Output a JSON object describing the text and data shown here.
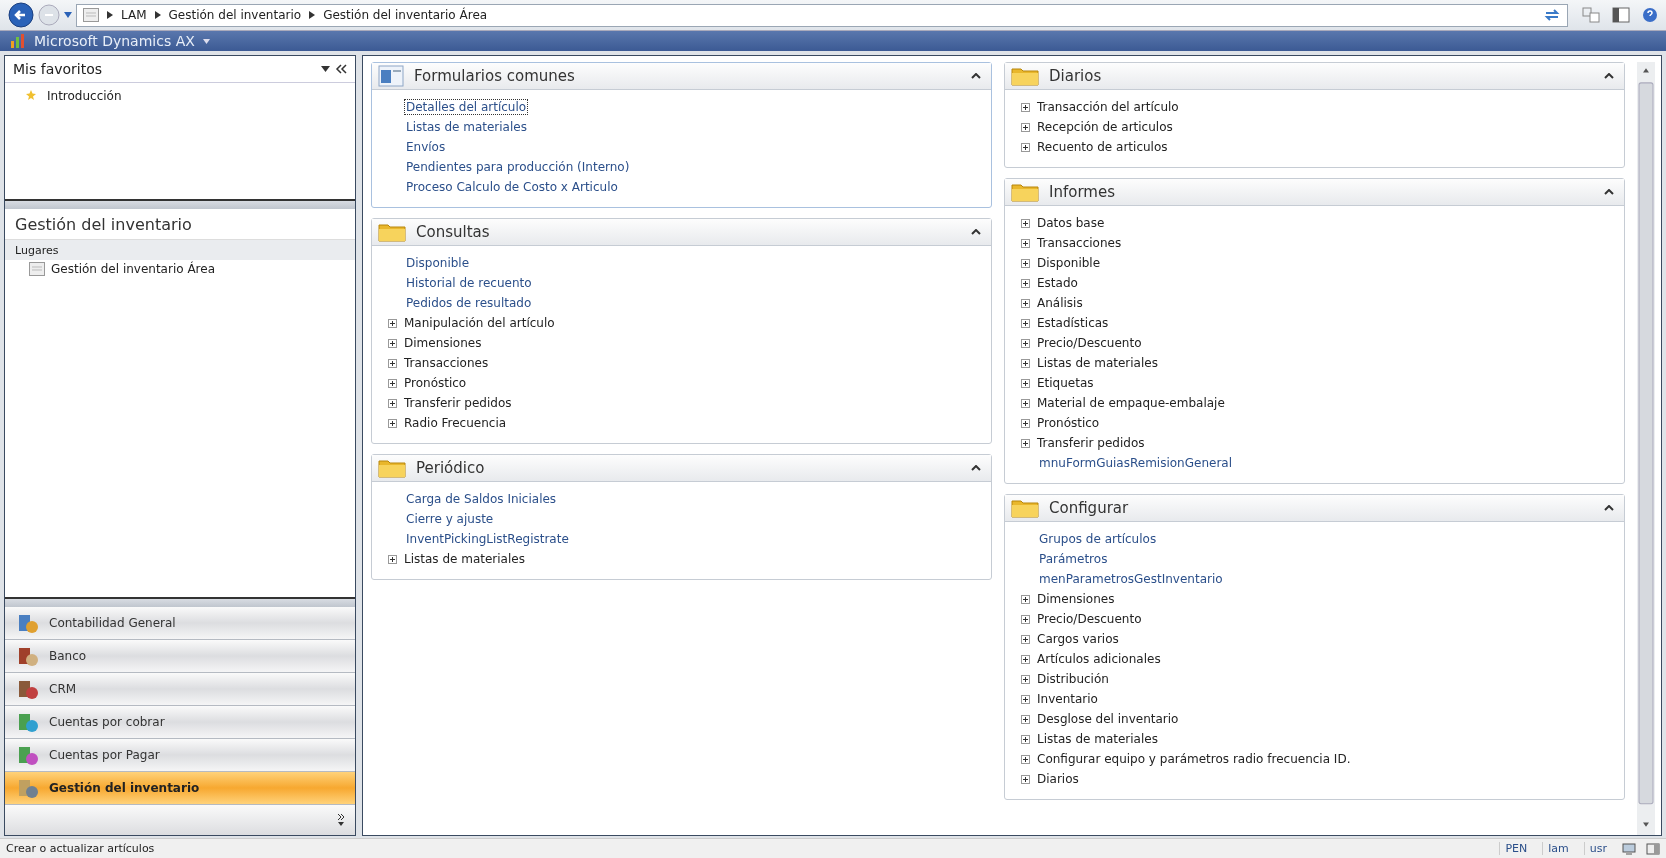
{
  "address_bar": {
    "breadcrumbs": [
      "LAM",
      "Gestión del inventario",
      "Gestión del inventario Área"
    ]
  },
  "app_bar": {
    "title": "Microsoft Dynamics AX"
  },
  "favorites": {
    "title": "Mis favoritos",
    "items": [
      "Introducción"
    ]
  },
  "area": {
    "title": "Gestión del inventario",
    "group": "Lugares",
    "items": [
      "Gestión del inventario Área"
    ]
  },
  "modules": [
    {
      "label": "Contabilidad General",
      "selected": false
    },
    {
      "label": "Banco",
      "selected": false
    },
    {
      "label": "CRM",
      "selected": false
    },
    {
      "label": "Cuentas por cobrar",
      "selected": false
    },
    {
      "label": "Cuentas por Pagar",
      "selected": false
    },
    {
      "label": "Gestión del inventario",
      "selected": true
    }
  ],
  "left_sections": [
    {
      "title": "Formularios comunes",
      "items": [
        {
          "label": "Detalles del artículo",
          "kind": "link",
          "focused": true
        },
        {
          "label": "Listas de materiales",
          "kind": "link",
          "focused": false
        },
        {
          "label": "Envíos",
          "kind": "link",
          "focused": false
        },
        {
          "label": "Pendientes para producción (Interno)",
          "kind": "link",
          "focused": false
        },
        {
          "label": "Proceso Calculo de Costo x Articulo",
          "kind": "link",
          "focused": false
        }
      ]
    },
    {
      "title": "Consultas",
      "items": [
        {
          "label": "Disponible",
          "kind": "link"
        },
        {
          "label": "Historial de recuento",
          "kind": "link"
        },
        {
          "label": "Pedidos de resultado",
          "kind": "link"
        },
        {
          "label": "Manipulación del artículo",
          "kind": "group"
        },
        {
          "label": "Dimensiones",
          "kind": "group"
        },
        {
          "label": "Transacciones",
          "kind": "group"
        },
        {
          "label": "Pronóstico",
          "kind": "group"
        },
        {
          "label": "Transferir pedidos",
          "kind": "group"
        },
        {
          "label": "Radio Frecuencia",
          "kind": "group"
        }
      ]
    },
    {
      "title": "Periódico",
      "items": [
        {
          "label": "Carga de Saldos Iniciales",
          "kind": "link"
        },
        {
          "label": "Cierre y ajuste",
          "kind": "link"
        },
        {
          "label": "InventPickingListRegistrate",
          "kind": "link"
        },
        {
          "label": "Listas de materiales",
          "kind": "group"
        }
      ]
    }
  ],
  "right_sections": [
    {
      "title": "Diarios",
      "items": [
        {
          "label": "Transacción del artículo",
          "kind": "group"
        },
        {
          "label": "Recepción de articulos",
          "kind": "group"
        },
        {
          "label": "Recuento de articulos",
          "kind": "group"
        }
      ]
    },
    {
      "title": "Informes",
      "items": [
        {
          "label": "Datos base",
          "kind": "group"
        },
        {
          "label": "Transacciones",
          "kind": "group"
        },
        {
          "label": "Disponible",
          "kind": "group"
        },
        {
          "label": "Estado",
          "kind": "group"
        },
        {
          "label": "Análisis",
          "kind": "group"
        },
        {
          "label": "Estadísticas",
          "kind": "group"
        },
        {
          "label": "Precio/Descuento",
          "kind": "group"
        },
        {
          "label": "Listas de materiales",
          "kind": "group"
        },
        {
          "label": "Etiquetas",
          "kind": "group"
        },
        {
          "label": "Material de empaque-embalaje",
          "kind": "group"
        },
        {
          "label": "Pronóstico",
          "kind": "group"
        },
        {
          "label": "Transferir pedidos",
          "kind": "group"
        },
        {
          "label": "mnuFormGuiasRemisionGeneral",
          "kind": "link"
        }
      ]
    },
    {
      "title": "Configurar",
      "items": [
        {
          "label": "Grupos de artículos",
          "kind": "link"
        },
        {
          "label": "Parámetros",
          "kind": "link"
        },
        {
          "label": "menParametrosGestInventario",
          "kind": "link"
        },
        {
          "label": "Dimensiones",
          "kind": "group"
        },
        {
          "label": "Precio/Descuento",
          "kind": "group"
        },
        {
          "label": "Cargos varios",
          "kind": "group"
        },
        {
          "label": "Artículos adicionales",
          "kind": "group"
        },
        {
          "label": "Distribución",
          "kind": "group"
        },
        {
          "label": "Inventario",
          "kind": "group"
        },
        {
          "label": "Desglose del inventario",
          "kind": "group"
        },
        {
          "label": "Listas de materiales",
          "kind": "group"
        },
        {
          "label": "Configurar equipo y parámetros radio frecuencia ID.",
          "kind": "group"
        },
        {
          "label": "Diarios",
          "kind": "group"
        }
      ]
    }
  ],
  "status_bar": {
    "message": "Crear o actualizar artículos",
    "indicators": [
      "PEN",
      "lam",
      "usr"
    ]
  }
}
